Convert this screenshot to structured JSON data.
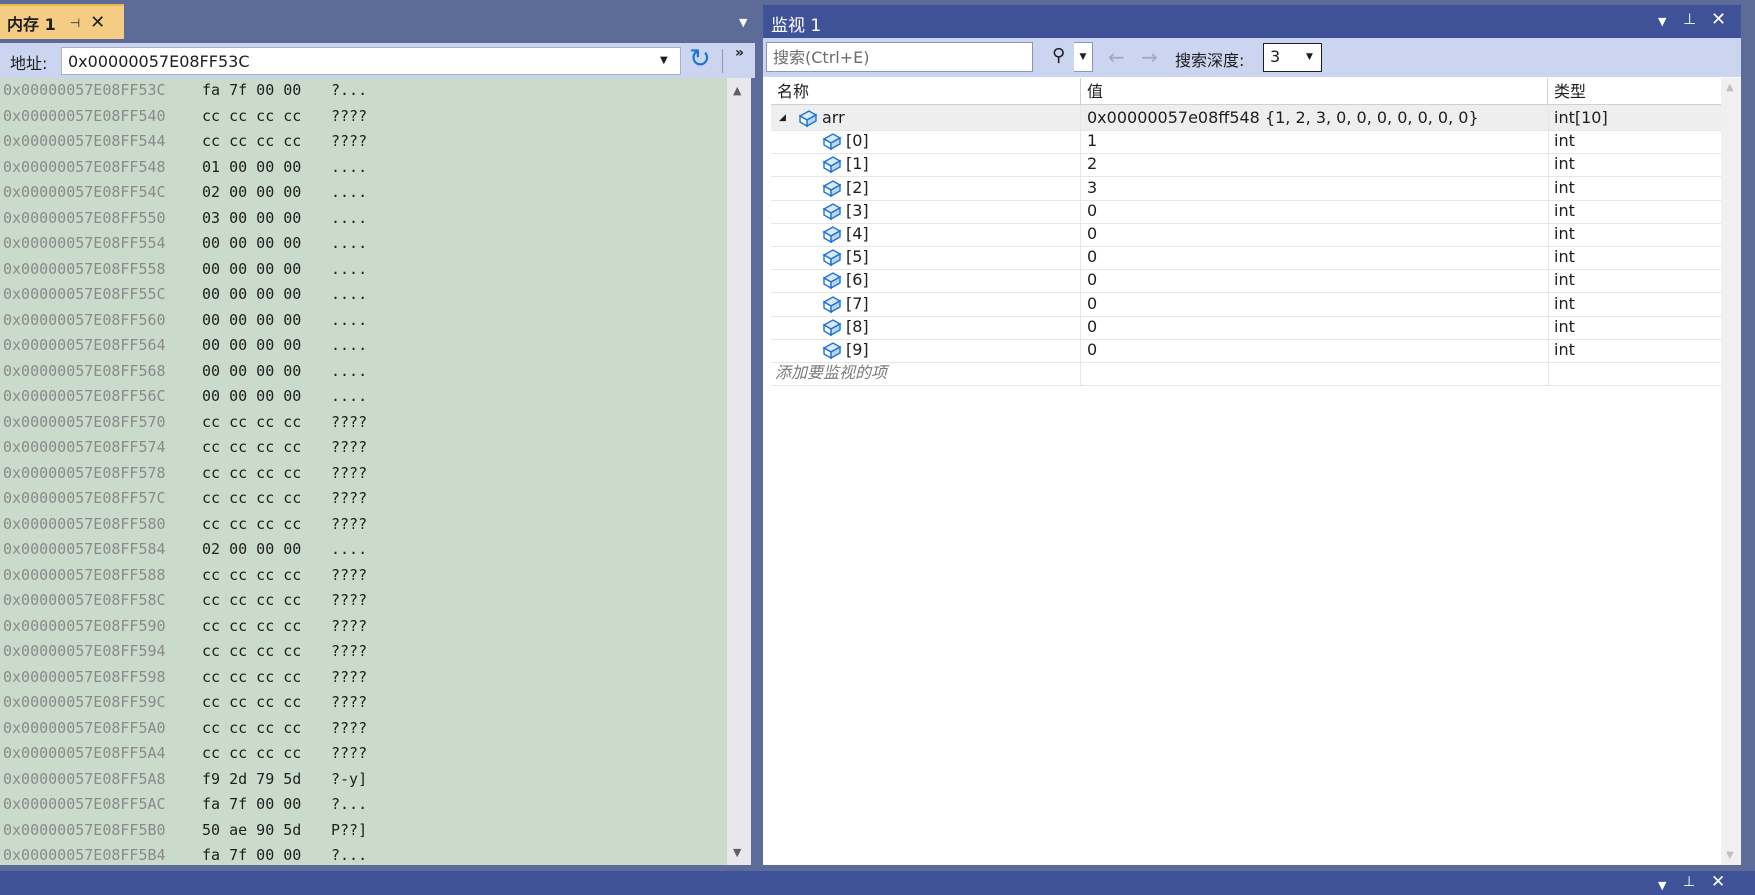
{
  "memory_window": {
    "tab_title": "内存 1",
    "pin_glyph": "⊣",
    "close_glyph": "✕",
    "address_label": "地址:",
    "address_value": "0x00000057E08FF53C",
    "refresh_glyph": "↻",
    "overflow_glyph": "»",
    "background_color": "#cadbcc",
    "rows": [
      {
        "addr": "0x00000057E08FF53C",
        "bytes": "fa 7f 00 00",
        "ascii": "?..."
      },
      {
        "addr": "0x00000057E08FF540",
        "bytes": "cc cc cc cc",
        "ascii": "????"
      },
      {
        "addr": "0x00000057E08FF544",
        "bytes": "cc cc cc cc",
        "ascii": "????"
      },
      {
        "addr": "0x00000057E08FF548",
        "bytes": "01 00 00 00",
        "ascii": "...."
      },
      {
        "addr": "0x00000057E08FF54C",
        "bytes": "02 00 00 00",
        "ascii": "...."
      },
      {
        "addr": "0x00000057E08FF550",
        "bytes": "03 00 00 00",
        "ascii": "...."
      },
      {
        "addr": "0x00000057E08FF554",
        "bytes": "00 00 00 00",
        "ascii": "...."
      },
      {
        "addr": "0x00000057E08FF558",
        "bytes": "00 00 00 00",
        "ascii": "...."
      },
      {
        "addr": "0x00000057E08FF55C",
        "bytes": "00 00 00 00",
        "ascii": "...."
      },
      {
        "addr": "0x00000057E08FF560",
        "bytes": "00 00 00 00",
        "ascii": "...."
      },
      {
        "addr": "0x00000057E08FF564",
        "bytes": "00 00 00 00",
        "ascii": "...."
      },
      {
        "addr": "0x00000057E08FF568",
        "bytes": "00 00 00 00",
        "ascii": "...."
      },
      {
        "addr": "0x00000057E08FF56C",
        "bytes": "00 00 00 00",
        "ascii": "...."
      },
      {
        "addr": "0x00000057E08FF570",
        "bytes": "cc cc cc cc",
        "ascii": "????"
      },
      {
        "addr": "0x00000057E08FF574",
        "bytes": "cc cc cc cc",
        "ascii": "????"
      },
      {
        "addr": "0x00000057E08FF578",
        "bytes": "cc cc cc cc",
        "ascii": "????"
      },
      {
        "addr": "0x00000057E08FF57C",
        "bytes": "cc cc cc cc",
        "ascii": "????"
      },
      {
        "addr": "0x00000057E08FF580",
        "bytes": "cc cc cc cc",
        "ascii": "????"
      },
      {
        "addr": "0x00000057E08FF584",
        "bytes": "02 00 00 00",
        "ascii": "...."
      },
      {
        "addr": "0x00000057E08FF588",
        "bytes": "cc cc cc cc",
        "ascii": "????"
      },
      {
        "addr": "0x00000057E08FF58C",
        "bytes": "cc cc cc cc",
        "ascii": "????"
      },
      {
        "addr": "0x00000057E08FF590",
        "bytes": "cc cc cc cc",
        "ascii": "????"
      },
      {
        "addr": "0x00000057E08FF594",
        "bytes": "cc cc cc cc",
        "ascii": "????"
      },
      {
        "addr": "0x00000057E08FF598",
        "bytes": "cc cc cc cc",
        "ascii": "????"
      },
      {
        "addr": "0x00000057E08FF59C",
        "bytes": "cc cc cc cc",
        "ascii": "????"
      },
      {
        "addr": "0x00000057E08FF5A0",
        "bytes": "cc cc cc cc",
        "ascii": "????"
      },
      {
        "addr": "0x00000057E08FF5A4",
        "bytes": "cc cc cc cc",
        "ascii": "????"
      },
      {
        "addr": "0x00000057E08FF5A8",
        "bytes": "f9 2d 79 5d",
        "ascii": "?-y]"
      },
      {
        "addr": "0x00000057E08FF5AC",
        "bytes": "fa 7f 00 00",
        "ascii": "?..."
      },
      {
        "addr": "0x00000057E08FF5B0",
        "bytes": "50 ae 90 5d",
        "ascii": "P??]"
      },
      {
        "addr": "0x00000057E08FF5B4",
        "bytes": "fa 7f 00 00",
        "ascii": "?..."
      }
    ]
  },
  "watch_window": {
    "title": "监视 1",
    "search_placeholder": "搜索(Ctrl+E)",
    "depth_label": "搜索深度:",
    "depth_value": "3",
    "columns": {
      "name": "名称",
      "value": "值",
      "type": "类型"
    },
    "root": {
      "name": "arr",
      "value": "0x00000057e08ff548 {1, 2, 3, 0, 0, 0, 0, 0, 0, 0}",
      "type": "int[10]"
    },
    "children": [
      {
        "name": "[0]",
        "value": "1",
        "type": "int"
      },
      {
        "name": "[1]",
        "value": "2",
        "type": "int"
      },
      {
        "name": "[2]",
        "value": "3",
        "type": "int"
      },
      {
        "name": "[3]",
        "value": "0",
        "type": "int"
      },
      {
        "name": "[4]",
        "value": "0",
        "type": "int"
      },
      {
        "name": "[5]",
        "value": "0",
        "type": "int"
      },
      {
        "name": "[6]",
        "value": "0",
        "type": "int"
      },
      {
        "name": "[7]",
        "value": "0",
        "type": "int"
      },
      {
        "name": "[8]",
        "value": "0",
        "type": "int"
      },
      {
        "name": "[9]",
        "value": "0",
        "type": "int"
      }
    ],
    "add_item_placeholder": "添加要监视的项",
    "icon_color": "#1a73d9"
  },
  "colors": {
    "frame": "#5d6b99",
    "active_title": "#3f5298",
    "active_tab": "#f5cc84",
    "toolbar": "#ccd5f0"
  }
}
